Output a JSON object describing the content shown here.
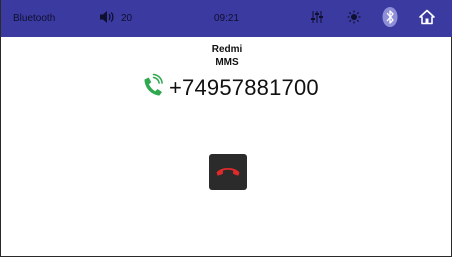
{
  "status_bar": {
    "source_label": "Bluetooth",
    "volume_value": "20",
    "time": "09:21",
    "icons": [
      "speaker-icon",
      "equalizer-icon",
      "brightness-icon",
      "bluetooth-icon",
      "home-icon"
    ]
  },
  "call": {
    "caller_name": "Redmi",
    "call_type": "MMS",
    "phone_number": "+74957881700",
    "icons": [
      "incoming-call-icon",
      "hang-up-icon"
    ]
  },
  "colors": {
    "status_bar_bg": "#3b3aa0",
    "incoming_call_green": "#2fa84f",
    "hang_up_red": "#e02a2a"
  }
}
